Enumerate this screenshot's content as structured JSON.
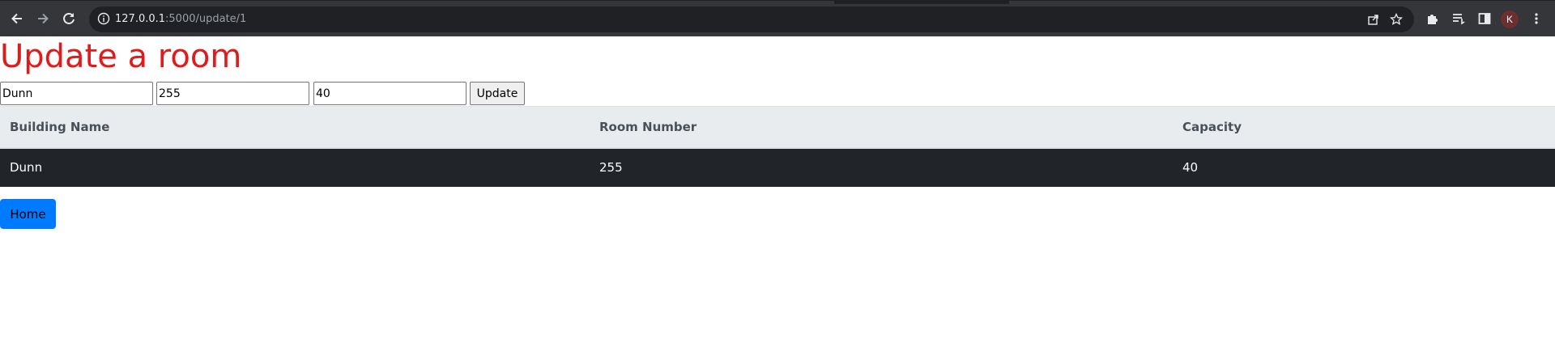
{
  "browser": {
    "url_host": "127.0.0.1",
    "url_path": ":5000/update/1",
    "profile_initial": "K",
    "icons": {
      "back": "arrow-left-icon",
      "forward": "arrow-right-icon",
      "reload": "reload-icon",
      "site_info": "info-icon",
      "share": "share-icon",
      "bookmark": "star-icon",
      "extensions": "puzzle-icon",
      "reading_list": "reading-list-icon",
      "side_panel": "side-panel-icon",
      "menu": "kebab-menu-icon"
    }
  },
  "page": {
    "title": "Update a room",
    "title_color": "#e01b1b",
    "form": {
      "building_value": "Dunn",
      "room_value": "255",
      "capacity_value": "40",
      "submit_label": "Update"
    },
    "table": {
      "headers": [
        "Building Name",
        "Room Number",
        "Capacity"
      ],
      "rows": [
        [
          "Dunn",
          "255",
          "40"
        ]
      ]
    },
    "home_label": "Home",
    "home_color": "#007bff"
  }
}
